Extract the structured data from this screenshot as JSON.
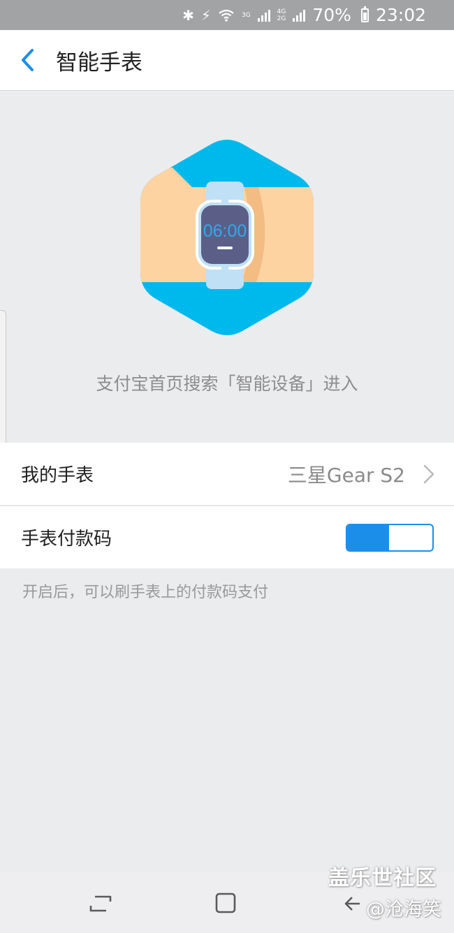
{
  "status_bar": {
    "network_top": "3G",
    "network_2_top": "4G",
    "network_2_bottom": "2G",
    "battery": "70%",
    "time": "23:02",
    "icons": [
      "bluetooth-icon",
      "flash-icon",
      "wifi-icon",
      "signal-icon",
      "battery-icon"
    ]
  },
  "header": {
    "title": "智能手表",
    "back_icon": "chevron-left-icon"
  },
  "hero": {
    "watch_time": "06:00",
    "colors": {
      "hexagon": "#00b9ec",
      "skin": "#fdd3a2",
      "strap": "#bfe0f5",
      "face": "#5b5f88",
      "digits": "#2fa9ec"
    }
  },
  "hint": "支付宝首页搜索「智能设备」进入",
  "settings": {
    "my_watch": {
      "label": "我的手表",
      "value": "三星Gear S2"
    },
    "pay_code": {
      "label": "手表付款码",
      "enabled": true
    },
    "note": "开启后，可以刷手表上的付款码支付"
  },
  "watermark": {
    "line1": "盖乐世社区",
    "line2": "@沧海笑"
  },
  "accent": "#1b8ee9"
}
